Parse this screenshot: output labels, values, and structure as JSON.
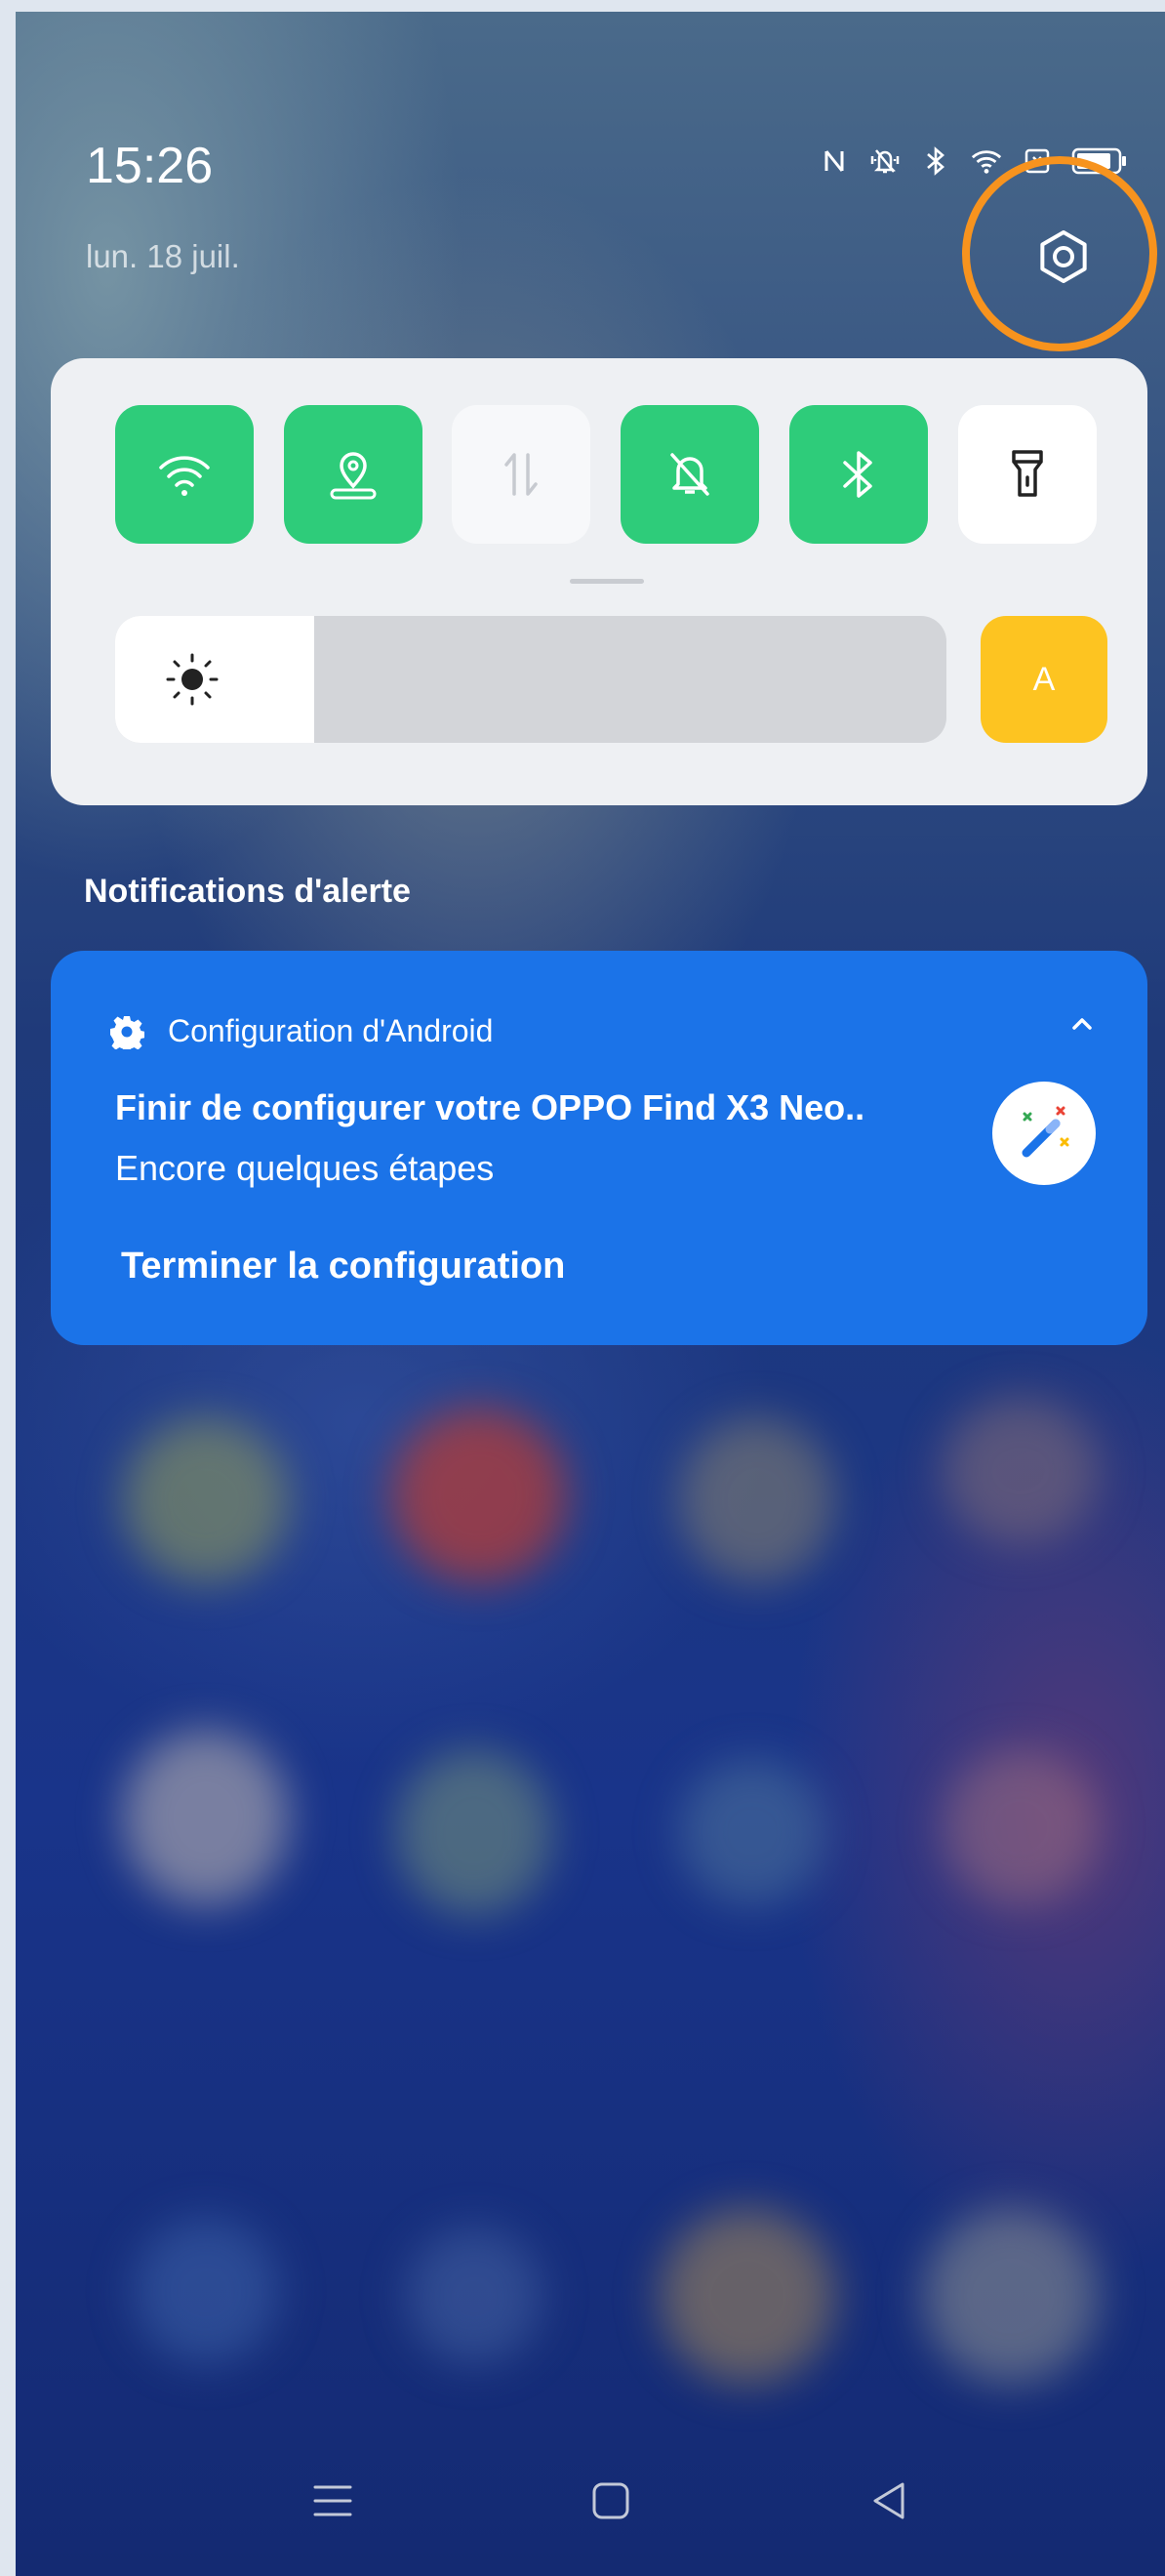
{
  "status_bar": {
    "time": "15:26",
    "date": "lun. 18 juil.",
    "icons": [
      "nfc-icon",
      "vibrate-icon",
      "bluetooth-icon",
      "wifi-icon",
      "sim-icon",
      "battery-icon"
    ]
  },
  "quick_settings": {
    "tiles": [
      {
        "name": "wifi",
        "icon": "wifi-icon",
        "active": true
      },
      {
        "name": "location",
        "icon": "location-icon",
        "active": true
      },
      {
        "name": "mobile-data",
        "icon": "data-arrows-icon",
        "active": false
      },
      {
        "name": "silent-mode",
        "icon": "bell-off-icon",
        "active": true
      },
      {
        "name": "bluetooth",
        "icon": "bluetooth-icon",
        "active": true
      },
      {
        "name": "flashlight",
        "icon": "flashlight-icon",
        "active": false
      }
    ],
    "brightness_level": 0.24,
    "auto_brightness_label": "A"
  },
  "notifications": {
    "section_title": "Notifications d'alerte",
    "items": [
      {
        "app_name": "Configuration d'Android",
        "title": "Finir de configurer votre OPPO Find X3 Neo..",
        "subtitle": "Encore quelques étapes",
        "action": "Terminer la configuration"
      }
    ]
  },
  "nav_bar": {
    "buttons": [
      "menu-icon",
      "home-icon",
      "back-icon"
    ]
  },
  "colors": {
    "tile_active": "#2ecc7a",
    "auto_button": "#fdc421",
    "notification_bg": "#1b73e8",
    "highlight_ring": "#f7931e"
  }
}
